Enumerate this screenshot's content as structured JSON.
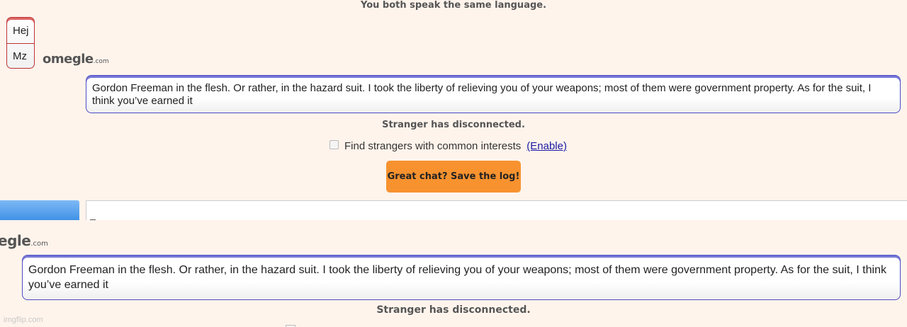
{
  "top_panel": {
    "lang_note": "You both speak the same language.",
    "sidebar_bubbles": [
      "Hej",
      "Mz"
    ],
    "logo_text": "omegle",
    "logo_domain": ".com",
    "message": "Gordon Freeman in the flesh. Or rather, in the hazard suit. I took the liberty of relieving you of your weapons; most of them were government property. As for the suit, I think you’ve earned it",
    "disconnected": "Stranger has disconnected.",
    "interests_label": "Find strangers with common interests",
    "enable_link": "(Enable)",
    "save_button": "Great chat? Save the log!"
  },
  "bottom_panel": {
    "logo_text": "egle",
    "logo_domain": ".com",
    "message": "Gordon Freeman in the flesh. Or rather, in the hazard suit. I took the liberty of relieving you of your weapons; most of them were government property. As for the suit, I think you’ve earned it",
    "disconnected": "Stranger has disconnected."
  },
  "watermark": "imgflip.com",
  "colors": {
    "background": "#fff4ec",
    "accent_orange": "#f7922f",
    "message_border": "#4b4bc4",
    "bubble_border": "#bb3333",
    "link": "#1a1aa6"
  }
}
